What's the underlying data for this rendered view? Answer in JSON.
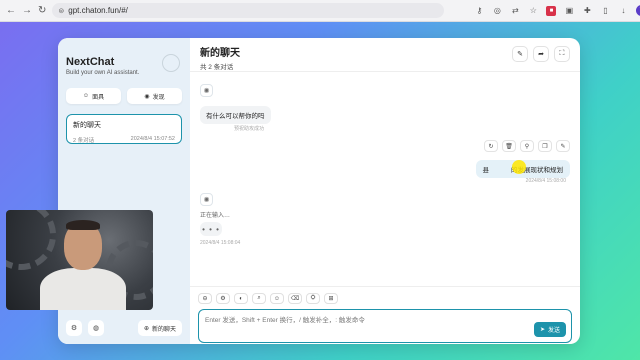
{
  "browser": {
    "url": "gpt.chaton.fun/#/"
  },
  "sidebar": {
    "title": "NextChat",
    "subtitle": "Build your own AI assistant.",
    "mask_label": "面具",
    "discover_label": "发现",
    "chats": [
      {
        "title": "新的聊天",
        "count": "2 条对话",
        "time": "2024/8/4 15:07:52"
      }
    ],
    "new_chat_label": "新的聊天"
  },
  "header": {
    "title": "新的聊天",
    "subtitle": "共 2 条对话"
  },
  "messages": {
    "bot_greeting": "有什么可以帮你的吗",
    "bot_greeting_time": "预祝助攻成功",
    "user_text_left": "县",
    "user_text_right": "的发展现状和规划",
    "user_time": "2024/8/4 15:08:00",
    "typing_label": "正在输入…",
    "typing_dots": "• • •",
    "typing_time": "2024/8/4 15:08:04"
  },
  "composer": {
    "placeholder": "Enter 发送，Shift + Enter 换行，/ 触发补全，: 触发命令",
    "send_label": "发送"
  },
  "colors": {
    "accent": "#1d93ab",
    "sidebar_bg": "#e7f0f8",
    "user_bubble": "#e4f1f8"
  }
}
